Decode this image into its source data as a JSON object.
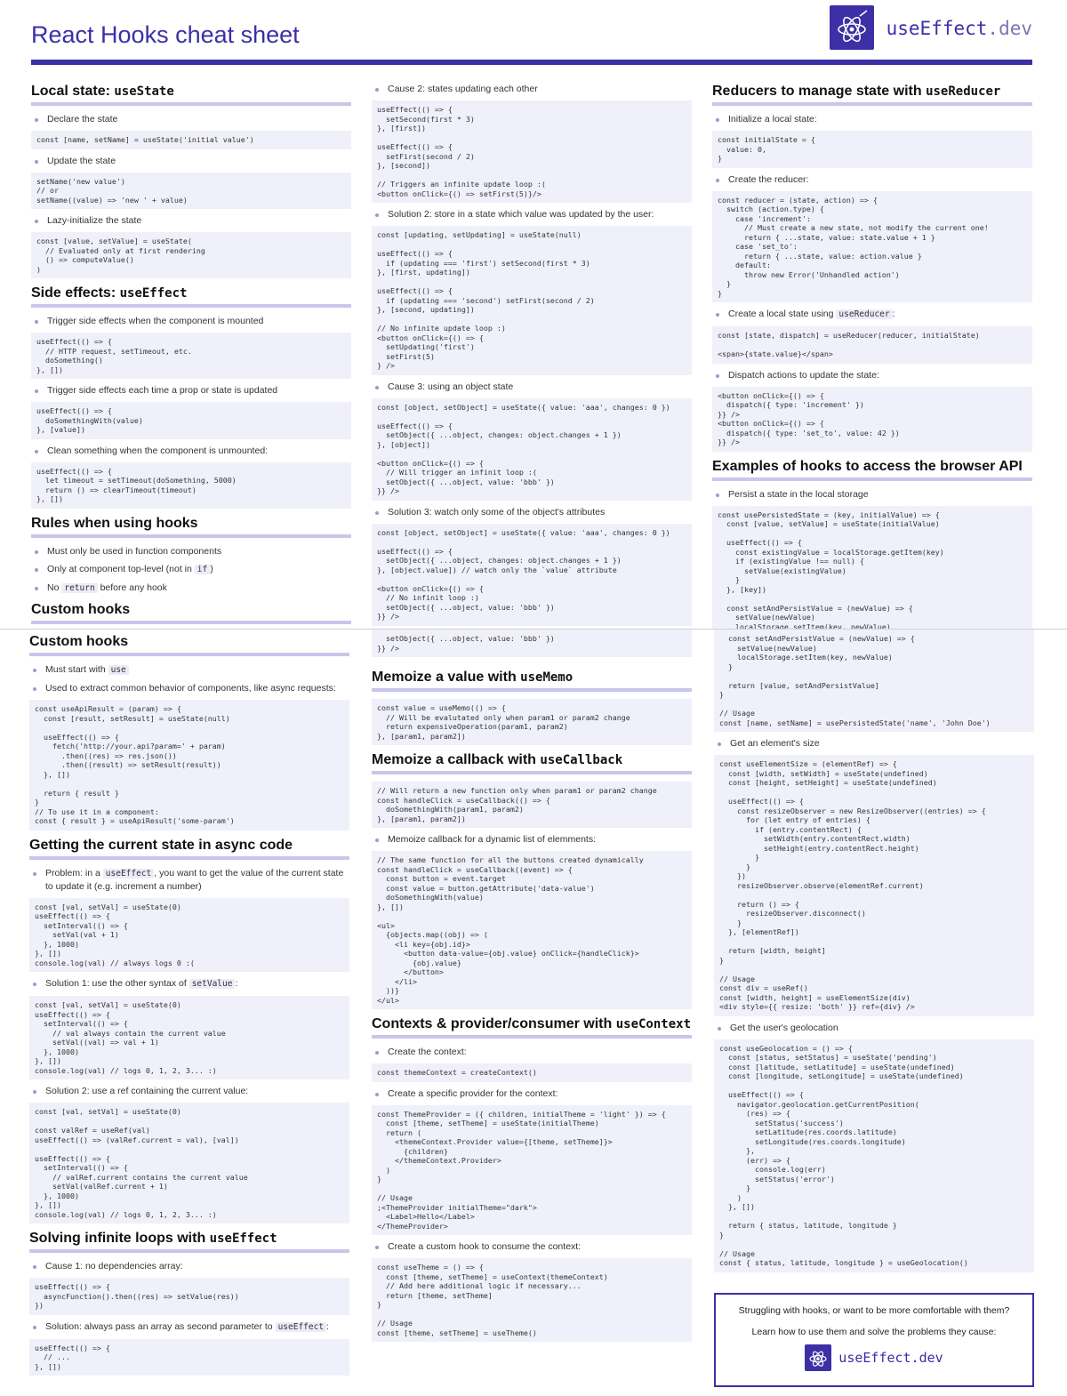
{
  "header": {
    "title": "React Hooks cheat sheet",
    "logo_text": "useEffect",
    "logo_suffix": ".dev"
  },
  "page1": {
    "useState": {
      "title": "Local state: ",
      "code_title": "useState",
      "items": [
        {
          "text": "Declare the state",
          "code": "const [name, setName] = useState('initial value')"
        },
        {
          "text": "Update the state",
          "code": "setName('new value')\n// or\nsetName((value) => 'new ' + value)"
        },
        {
          "text": "Lazy-initialize the state",
          "code": "const [value, setValue] = useState(\n  // Evaluated only at first rendering\n  () => computeValue()\n)"
        }
      ]
    },
    "useEffect": {
      "title": "Side effects: ",
      "code_title": "useEffect",
      "items": [
        {
          "text": "Trigger side effects when the component is mounted",
          "code": "useEffect(() => {\n  // HTTP request, setTimeout, etc.\n  doSomething()\n}, [])"
        },
        {
          "text": "Trigger side effects each time a prop or state is updated",
          "code": "useEffect(() => {\n  doSomethingWith(value)\n}, [value])"
        },
        {
          "text": "Clean something when the component is unmounted:",
          "code": "useEffect(() => {\n  let timeout = setTimeout(doSomething, 5000)\n  return () => clearTimeout(timeout)\n}, [])"
        }
      ]
    },
    "rules": {
      "title": "Rules when using hooks",
      "b1": "Must only be used in function components",
      "b2_pre": "Only at component top-level (not in ",
      "b2_code": "if",
      "b2_post": ")",
      "b3_pre": "No ",
      "b3_code": "return",
      "b3_post": " before any hook"
    },
    "custom_teaser": "Custom hooks",
    "loops": {
      "c2": "Cause 2: states updating each other",
      "c2_code": "useEffect(() => {\n  setSecond(first * 3)\n}, [first])\n\nuseEffect(() => {\n  setFirst(second / 2)\n}, [second])\n\n// Triggers an infinite update loop :(\n<button onClick={() => setFirst(5)}/>",
      "s2": "Solution 2: store in a state which value was updated by the user:",
      "s2_code": "const [updating, setUpdating] = useState(null)\n\nuseEffect(() => {\n  if (updating === 'first') setSecond(first * 3)\n}, [first, updating])\n\nuseEffect(() => {\n  if (updating === 'second') setFirst(second / 2)\n}, [second, updating])\n\n// No infinite update loop :)\n<button onClick={() => {\n  setUpdating('first')\n  setFirst(5)\n} />",
      "c3": "Cause 3: using an object state",
      "c3_code": "const [object, setObject] = useState({ value: 'aaa', changes: 0 })\n\nuseEffect(() => {\n  setObject({ ...object, changes: object.changes + 1 })\n}, [object])\n\n<button onClick={() => {\n  // Will trigger an infinit loop :(\n  setObject({ ...object, value: 'bbb' })\n}} />",
      "s3": "Solution 3: watch only some of the object's attributes",
      "s3_code": "const [object, setObject] = useState({ value: 'aaa', changes: 0 })\n\nuseEffect(() => {\n  setObject({ ...object, changes: object.changes + 1 })\n}, [object.value]) // watch only the `value` attribute\n\n<button onClick={() => {\n  // No infinit loop :)\n  setObject({ ...object, value: 'bbb' })\n}} />"
    },
    "reducer": {
      "title": "Reducers to manage state with ",
      "code_title": "useReducer",
      "i1": "Initialize a local state:",
      "i1_code": "const initialState = {\n  value: 0,\n}",
      "i2": "Create the reducer:",
      "i2_code": "const reducer = (state, action) => {\n  switch (action.type) {\n    case 'increment':\n      // Must create a new state, not modify the current one!\n      return { ...state, value: state.value + 1 }\n    case 'set_to':\n      return { ...state, value: action.value }\n    default:\n      throw new Error('Unhandled action')\n  }\n}",
      "i3_pre": "Create a local state using ",
      "i3_code_inline": "useReducer",
      "i3_post": ":",
      "i3_code": "const [state, dispatch] = useReducer(reducer, initialState)\n\n<span>{state.value}</span>",
      "i4": "Dispatch actions to update the state:",
      "i4_code": "<button onClick={() => {\n  dispatch({ type: 'increment' })\n}} />\n<button onClick={() => {\n  dispatch({ type: 'set_to', value: 42 })\n}} />"
    },
    "browser": {
      "title": "Examples of hooks to access the browser API",
      "i1": "Persist a state in the local storage",
      "i1_code": "const usePersistedState = (key, initialValue) => {\n  const [value, setValue] = useState(initialValue)\n\n  useEffect(() => {\n    const existingValue = localStorage.getItem(key)\n    if (existingValue !== null) {\n      setValue(existingValue)\n    }\n  }, [key])\n\n  const setAndPersistValue = (newValue) => {\n    setValue(newValue)\n    localStorage.setItem(key, newValue)"
    }
  },
  "page2": {
    "custom": {
      "title": "Custom hooks",
      "b1_pre": "Must start with ",
      "b1_code": "use",
      "b2": "Used to extract common behavior of components, like async requests:",
      "code": "const useApiResult = (param) => {\n  const [result, setResult] = useState(null)\n\n  useEffect(() => {\n    fetch('http://your.api?param=' + param)\n      .then((res) => res.json())\n      .then((result) => setResult(result))\n  }, [])\n\n  return { result }\n}\n// To use it in a component:\nconst { result } = useApiResult('some-param')"
    },
    "async": {
      "title": "Getting the current state in async code",
      "p_pre": "Problem: in a ",
      "p_code": "useEffect",
      "p_post": ", you want to get the value of the current state to update it (e.g. increment a number)",
      "p_codeblock": "const [val, setVal] = useState(0)\nuseEffect(() => {\n  setInterval(() => {\n    setVal(val + 1)\n  }, 1000)\n}, [])\nconsole.log(val) // always logs 0 :(",
      "s1_pre": "Solution 1: use the other syntax of ",
      "s1_code": "setValue",
      "s1_post": ":",
      "s1_codeblock": "const [val, setVal] = useState(0)\nuseEffect(() => {\n  setInterval(() => {\n    // val always contain the current value\n    setVal((val) => val + 1)\n  }, 1000)\n}, [])\nconsole.log(val) // logs 0, 1, 2, 3... :)",
      "s2": "Solution 2: use a ref containing the current value:",
      "s2_codeblock": "const [val, setVal] = useState(0)\n\nconst valRef = useRef(val)\nuseEffect(() => (valRef.current = val), [val])\n\nuseEffect(() => {\n  setInterval(() => {\n    // valRef.current contains the current value\n    setVal(valRef.current + 1)\n  }, 1000)\n}, [])\nconsole.log(val) // logs 0, 1, 2, 3... :)"
    },
    "loops": {
      "title": "Solving infinite loops with ",
      "code_title": "useEffect",
      "c1": "Cause 1: no dependencies array:",
      "c1_code": "useEffect(() => {\n  asyncFunction().then((res) => setValue(res))\n})",
      "s1_pre": "Solution: always pass an array as second parameter to ",
      "s1_code": "useEffect",
      "s1_post": ":",
      "s1_codeblock": "useEffect(() => {\n  // ...\n}, [])"
    },
    "loops_tail": "  setObject({ ...object, value: 'bbb' })\n}} />",
    "memo": {
      "title": "Memoize a value with ",
      "code_title": "useMemo",
      "code": "const value = useMemo(() => {\n  // Will be evalutated only when param1 or param2 change\n  return expensiveOperation(param1, param2)\n}, [param1, param2])"
    },
    "callback": {
      "title": "Memoize a callback with ",
      "code_title": "useCallback",
      "code": "// Will return a new function only when param1 or param2 change\nconst handleClick = useCallback(() => {\n  doSomethingWith(param1, param2)\n}, [param1, param2])",
      "b1": "Memoize callback for a dynamic list of elemments:",
      "b1_code": "// The same function for all the buttons created dynamically\nconst handleClick = useCallback((event) => {\n  const button = event.target\n  const value = button.getAttribute('data-value')\n  doSomethingWith(value)\n}, [])\n\n<ul>\n  {objects.map((obj) => (\n    <li key={obj.id}>\n      <button data-value={obj.value} onClick={handleClick}>\n        {obj.value}\n      </button>\n    </li>\n  ))}\n</ul>"
    },
    "context": {
      "title": "Contexts & provider/consumer with ",
      "code_title": "useContext",
      "i1": "Create the context:",
      "i1_code": "const themeContext = createContext()",
      "i2": "Create a specific provider for the context:",
      "i2_code": "const ThemeProvider = ({ children, initialTheme = 'light' }) => {\n  const [theme, setTheme] = useState(initialTheme)\n  return (\n    <themeContext.Provider value={[theme, setTheme]}>\n      {children}\n    </themeContext.Provider>\n  )\n}\n\n// Usage\n;<ThemeProvider initialTheme=\"dark\">\n  <Label>Hello</Label>\n</ThemeProvider>",
      "i3": "Create a custom hook to consume the context:",
      "i3_code": "const useTheme = () => {\n  const [theme, setTheme] = useContext(themeContext)\n  // Add here additional logic if necessary...\n  return [theme, setTheme]\n}\n\n// Usage\nconst [theme, setTheme] = useTheme()"
    },
    "browser_cont": {
      "code": "  const setAndPersistValue = (newValue) => {\n    setValue(newValue)\n    localStorage.setItem(key, newValue)\n  }\n\n  return [value, setAndPersistValue]\n}\n\n// Usage\nconst [name, setName] = usePersistedState('name', 'John Doe')",
      "i2": "Get an element's size",
      "i2_code": "const useElementSize = (elementRef) => {\n  const [width, setWidth] = useState(undefined)\n  const [height, setHeight] = useState(undefined)\n\n  useEffect(() => {\n    const resizeObserver = new ResizeObserver((entries) => {\n      for (let entry of entries) {\n        if (entry.contentRect) {\n          setWidth(entry.contentRect.width)\n          setHeight(entry.contentRect.height)\n        }\n      }\n    })\n    resizeObserver.observe(elementRef.current)\n\n    return () => {\n      resizeObserver.disconnect()\n    }\n  }, [elementRef])\n\n  return [width, height]\n}\n\n// Usage\nconst div = useRef()\nconst [width, height] = useElementSize(div)\n<div style={{ resize: 'both' }} ref={div} />",
      "i3": "Get the user's geolocation",
      "i3_code": "const useGeolocation = () => {\n  const [status, setStatus] = useState('pending')\n  const [latitude, setLatitude] = useState(undefined)\n  const [longitude, setLongitude] = useState(undefined)\n\n  useEffect(() => {\n    navigator.geolocation.getCurrentPosition(\n      (res) => {\n        setStatus('success')\n        setLatitude(res.coords.latitude)\n        setLongitude(res.coords.longitude)\n      },\n      (err) => {\n        console.log(err)\n        setStatus('error')\n      }\n    )\n  }, [])\n\n  return { status, latitude, longitude }\n}\n\n// Usage\nconst { status, latitude, longitude } = useGeolocation()"
    },
    "cta": {
      "line1": "Struggling with hooks, or want to be more comfortable with them?",
      "line2": "Learn how to use them and solve the problems they cause:",
      "brand": "useEffect.dev"
    }
  },
  "colors": {
    "accent": "#3d2fa5",
    "rule": "#c8c6ea",
    "code_bg": "#eff0fa"
  }
}
